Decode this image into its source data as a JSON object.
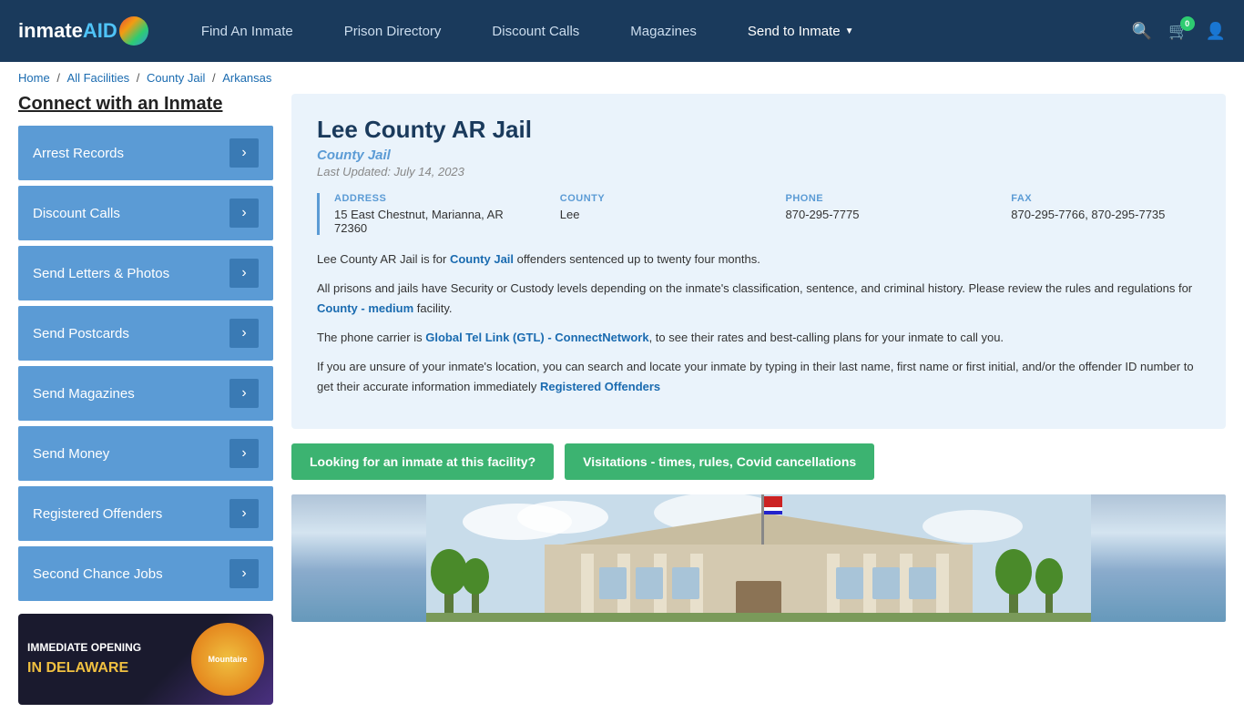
{
  "header": {
    "logo_text": "inmateAID",
    "logo_badge": "0",
    "nav_items": [
      {
        "label": "Find An Inmate",
        "id": "find-inmate"
      },
      {
        "label": "Prison Directory",
        "id": "prison-directory"
      },
      {
        "label": "Discount Calls",
        "id": "discount-calls"
      },
      {
        "label": "Magazines",
        "id": "magazines"
      },
      {
        "label": "Send to Inmate",
        "id": "send-to-inmate",
        "has_chevron": true
      }
    ],
    "cart_count": "0"
  },
  "breadcrumb": {
    "items": [
      "Home",
      "All Facilities",
      "County Jail",
      "Arkansas"
    ]
  },
  "sidebar": {
    "title": "Connect with an Inmate",
    "items": [
      {
        "label": "Arrest Records"
      },
      {
        "label": "Discount Calls"
      },
      {
        "label": "Send Letters & Photos"
      },
      {
        "label": "Send Postcards"
      },
      {
        "label": "Send Magazines"
      },
      {
        "label": "Send Money"
      },
      {
        "label": "Registered Offenders"
      },
      {
        "label": "Second Chance Jobs"
      }
    ],
    "ad": {
      "line1": "IMMEDIATE OPENING",
      "line2": "IN DELAWARE",
      "badge": "Mountaire"
    }
  },
  "facility": {
    "title": "Lee County AR Jail",
    "type": "County Jail",
    "last_updated": "Last Updated: July 14, 2023",
    "address_label": "ADDRESS",
    "address_value": "15 East Chestnut, Marianna, AR 72360",
    "county_label": "COUNTY",
    "county_value": "Lee",
    "phone_label": "PHONE",
    "phone_value": "870-295-7775",
    "fax_label": "FAX",
    "fax_value": "870-295-7766, 870-295-7735",
    "desc1": "Lee County AR Jail is for County Jail offenders sentenced up to twenty four months.",
    "desc2": "All prisons and jails have Security or Custody levels depending on the inmate's classification, sentence, and criminal history. Please review the rules and regulations for County - medium facility.",
    "desc3": "The phone carrier is Global Tel Link (GTL) - ConnectNetwork, to see their rates and best-calling plans for your inmate to call you.",
    "desc4": "If you are unsure of your inmate's location, you can search and locate your inmate by typing in their last name, first name or first initial, and/or the offender ID number to get their accurate information immediately Registered Offenders",
    "btn1": "Looking for an inmate at this facility?",
    "btn2": "Visitations - times, rules, Covid cancellations"
  }
}
